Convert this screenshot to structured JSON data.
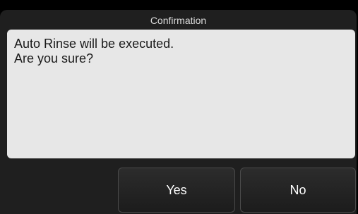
{
  "dialog": {
    "title": "Confirmation",
    "message_lines": [
      "Auto Rinse will be executed.",
      "Are you sure?"
    ],
    "buttons": {
      "yes_label": "Yes",
      "no_label": "No"
    }
  },
  "colors": {
    "background": "#000000",
    "frame": "#1f1f1f",
    "message_bg": "#e7e7e7",
    "button_text": "#ffffff"
  }
}
